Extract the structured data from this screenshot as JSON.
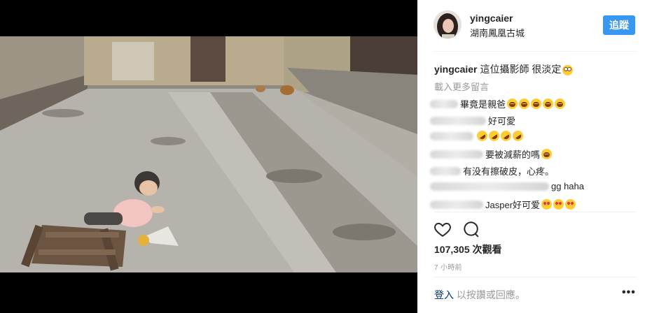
{
  "post": {
    "username": "yingcaier",
    "location": "湖南鳳凰古城",
    "follow_label": "追蹤"
  },
  "caption": {
    "username": "yingcaier",
    "text": "這位攝影師 很淡定"
  },
  "load_more": "載入更多留言",
  "comments": [
    {
      "text": "畢竟是親爸",
      "emoji": [
        "laugh",
        "laugh",
        "laugh",
        "laugh",
        "laugh"
      ]
    },
    {
      "text": "好可愛",
      "emoji": []
    },
    {
      "text": "",
      "emoji": [
        "rofl",
        "rofl",
        "rofl",
        "rofl"
      ]
    },
    {
      "text": "要被減薪的嗎",
      "emoji": [
        "laugh"
      ]
    },
    {
      "text": "有没有擦破皮，心疼。",
      "emoji": []
    },
    {
      "text": "gg haha",
      "emoji": []
    },
    {
      "text": "Jasper好可爱",
      "emoji": [
        "heart",
        "heart",
        "heart"
      ]
    }
  ],
  "views_label": "107,305 次觀看",
  "time_label": "7 小時前",
  "login": {
    "link": "登入",
    "rest": " 以按讚或回應。"
  },
  "more_label": "•••"
}
